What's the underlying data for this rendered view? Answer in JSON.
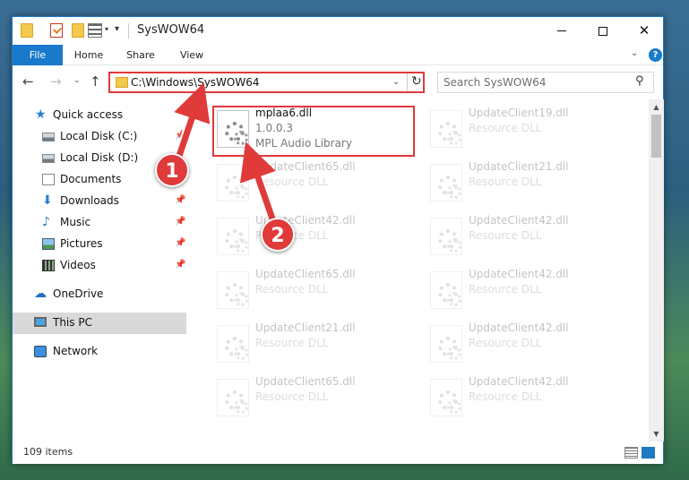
{
  "window": {
    "title": "SysWOW64",
    "min_label": "",
    "max_label": "",
    "close_label": "✕"
  },
  "quick_access_toolbar": {
    "dropdown_glyph": "▾",
    "customize_glyph": "▾"
  },
  "ribbon": {
    "tabs": [
      {
        "label": "File"
      },
      {
        "label": "Home"
      },
      {
        "label": "Share"
      },
      {
        "label": "View"
      }
    ],
    "expand_glyph": "⌄",
    "help_label": "?"
  },
  "navigation": {
    "back_glyph": "←",
    "forward_glyph": "→",
    "recent_glyph": "⌄",
    "up_glyph": "↑",
    "address": "C:\\Windows\\SysWOW64",
    "address_dropdown_glyph": "⌄",
    "refresh_glyph": "↻",
    "search_placeholder": "Search SysWOW64",
    "search_glyph": "⚲"
  },
  "sidebar": {
    "items": [
      {
        "label": "Quick access",
        "icon": "star-icon",
        "pinned": false,
        "selected": false
      },
      {
        "label": "Local Disk (C:)",
        "icon": "disk-icon",
        "pinned": true,
        "selected": false
      },
      {
        "label": "Local Disk (D:)",
        "icon": "disk-icon",
        "pinned": false,
        "selected": false
      },
      {
        "label": "Documents",
        "icon": "document-icon",
        "pinned": true,
        "selected": false
      },
      {
        "label": "Downloads",
        "icon": "download-icon",
        "pinned": true,
        "selected": false
      },
      {
        "label": "Music",
        "icon": "music-icon",
        "pinned": true,
        "selected": false
      },
      {
        "label": "Pictures",
        "icon": "picture-icon",
        "pinned": true,
        "selected": false
      },
      {
        "label": "Videos",
        "icon": "video-icon",
        "pinned": true,
        "selected": false
      },
      {
        "label": "OneDrive",
        "icon": "cloud-icon",
        "pinned": false,
        "selected": false
      },
      {
        "label": "This PC",
        "icon": "computer-icon",
        "pinned": false,
        "selected": true
      },
      {
        "label": "Network",
        "icon": "network-icon",
        "pinned": false,
        "selected": false
      }
    ],
    "pin_glyph": "📌"
  },
  "files": [
    {
      "name": "mplaa6.dll",
      "line2": "1.0.0.3",
      "line3": "MPL Audio Library",
      "highlighted": true
    },
    {
      "name": "UpdateClient19.dll",
      "line2": "Resource DLL",
      "line3": "",
      "highlighted": false
    },
    {
      "name": "UpdateClient65.dll",
      "line2": "Resource DLL",
      "line3": "",
      "highlighted": false
    },
    {
      "name": "UpdateClient21.dll",
      "line2": "Resource DLL",
      "line3": "",
      "highlighted": false
    },
    {
      "name": "UpdateClient42.dll",
      "line2": "Resource DLL",
      "line3": "",
      "highlighted": false
    },
    {
      "name": "UpdateClient42.dll",
      "line2": "Resource DLL",
      "line3": "",
      "highlighted": false
    },
    {
      "name": "UpdateClient65.dll",
      "line2": "Resource DLL",
      "line3": "",
      "highlighted": false
    },
    {
      "name": "UpdateClient42.dll",
      "line2": "Resource DLL",
      "line3": "",
      "highlighted": false
    },
    {
      "name": "UpdateClient21.dll",
      "line2": "Resource DLL",
      "line3": "",
      "highlighted": false
    },
    {
      "name": "UpdateClient42.dll",
      "line2": "Resource DLL",
      "line3": "",
      "highlighted": false
    },
    {
      "name": "UpdateClient65.dll",
      "line2": "Resource DLL",
      "line3": "",
      "highlighted": false
    },
    {
      "name": "UpdateClient42.dll",
      "line2": "Resource DLL",
      "line3": "",
      "highlighted": false
    }
  ],
  "scrollbar": {
    "up_glyph": "▲",
    "down_glyph": "▼"
  },
  "status": {
    "item_count": "109 items"
  },
  "annotations": {
    "callout_1": "1",
    "callout_2": "2",
    "accent_color": "#e03a3a"
  }
}
